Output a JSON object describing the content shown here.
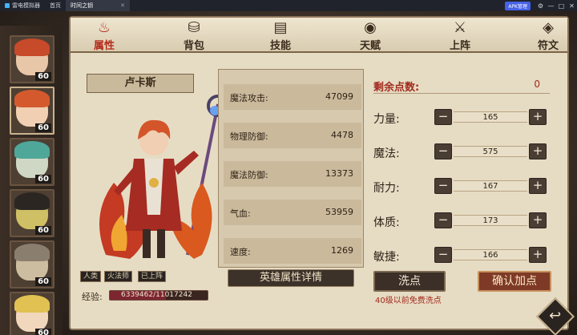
{
  "titlebar": {
    "app_name": "雷电模拟器",
    "home_tab": "首页",
    "game_tab": "时间之钥",
    "badge": "APK管理",
    "controls": [
      "⚙",
      "—",
      "□",
      "✕"
    ]
  },
  "tabs": [
    {
      "label": "属性",
      "icon": "flame-icon",
      "glyph": "♨"
    },
    {
      "label": "背包",
      "icon": "bag-icon",
      "glyph": "⛁"
    },
    {
      "label": "技能",
      "icon": "book-icon",
      "glyph": "▤"
    },
    {
      "label": "天赋",
      "icon": "eye-icon",
      "glyph": "◉"
    },
    {
      "label": "上阵",
      "icon": "swords-icon",
      "glyph": "⚔"
    },
    {
      "label": "符文",
      "icon": "rune-icon",
      "glyph": "◈"
    }
  ],
  "heroes": [
    {
      "level": "60",
      "hair": "#c74a2a",
      "face": "#e8c6a8",
      "cls": "♥"
    },
    {
      "level": "60",
      "hair": "#d45a2e",
      "face": "#f0cfb2",
      "cls": "✦"
    },
    {
      "level": "60",
      "hair": "#4fa79a",
      "face": "#cfd8c4",
      "cls": "♣"
    },
    {
      "level": "60",
      "hair": "#2b2622",
      "face": "#cfc066",
      "cls": "✦"
    },
    {
      "level": "60",
      "hair": "#8a7e6e",
      "face": "#cdbda0",
      "cls": "✕"
    },
    {
      "level": "60",
      "hair": "#e0c152",
      "face": "#f1d7bb",
      "cls": "✤"
    }
  ],
  "hero": {
    "name": "卢卡斯",
    "tags": [
      "人类",
      "火法师",
      "已上阵"
    ],
    "exp_label": "经验:",
    "exp_text": "6339462/11017242",
    "exp_fraction": 0.575
  },
  "stats": [
    {
      "label": "魔法攻击:",
      "value": "47099"
    },
    {
      "label": "物理防御:",
      "value": "4478"
    },
    {
      "label": "魔法防御:",
      "value": "13373"
    },
    {
      "label": "气血:",
      "value": "53959"
    },
    {
      "label": "速度:",
      "value": "1269"
    }
  ],
  "attributes": {
    "remaining_label": "剩余点数:",
    "remaining_value": "0",
    "rows": [
      {
        "label": "力量:",
        "value": "165"
      },
      {
        "label": "魔法:",
        "value": "575"
      },
      {
        "label": "耐力:",
        "value": "167"
      },
      {
        "label": "体质:",
        "value": "173"
      },
      {
        "label": "敏捷:",
        "value": "166"
      }
    ],
    "minus": "−",
    "plus": "+"
  },
  "buttons": {
    "detail": "英雄属性详情",
    "wash": "洗点",
    "confirm": "确认加点",
    "wash_note": "40级以前免费洗点"
  },
  "colors": {
    "accent_red": "#a12a1d",
    "panel": "#e6dcc4",
    "confirm_button": "#7e3a26"
  }
}
